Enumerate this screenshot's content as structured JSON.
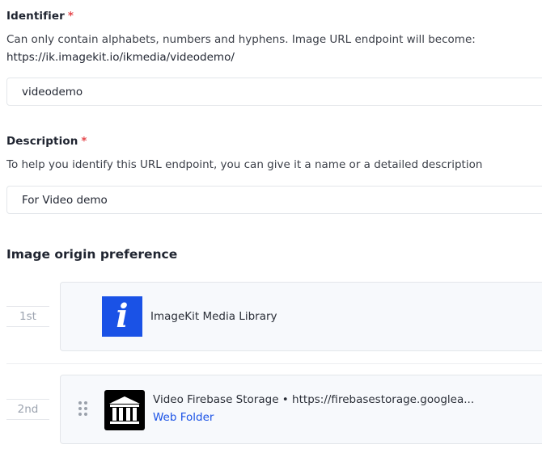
{
  "identifier": {
    "label": "Identifier",
    "required_mark": "*",
    "help": "Can only contain alphabets, numbers and hyphens. Image URL endpoint will become:",
    "endpoint_url": "https://ik.imagekit.io/ikmedia/videodemo/",
    "value": "videodemo"
  },
  "description": {
    "label": "Description",
    "required_mark": "*",
    "help": "To help you identify this URL endpoint, you can give it a name or a detailed description",
    "value": "For Video demo"
  },
  "origins": {
    "title": "Image origin preference",
    "items": [
      {
        "rank": "1st",
        "name": "ImageKit Media Library",
        "logo": "imagekit-logo",
        "logo_letter": "i",
        "logo_color": "#1a52e6"
      },
      {
        "rank": "2nd",
        "name": "Video Firebase Storage • https://firebasestorage.googlea...",
        "subtitle": "Web Folder",
        "logo": "web-folder-building-icon",
        "logo_color": "#000000"
      }
    ]
  },
  "colors": {
    "required": "#e5484d",
    "link": "#1a52e6",
    "card_bg": "#f7f9fc",
    "border": "#e3e6ea"
  }
}
